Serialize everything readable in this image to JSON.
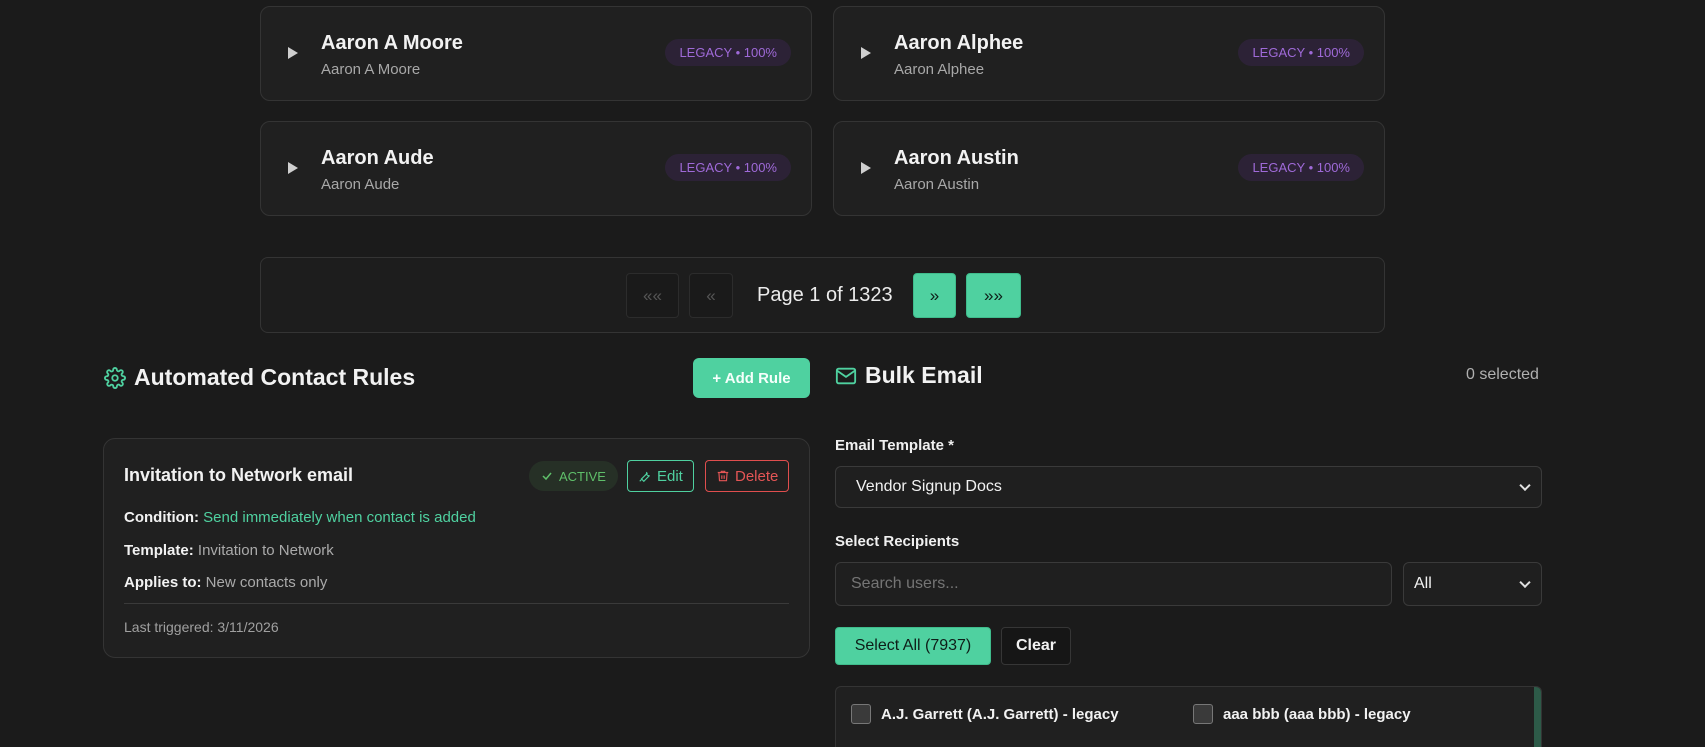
{
  "cards": [
    {
      "name": "Aaron A Moore",
      "sub": "Aaron A Moore",
      "badge": "LEGACY • 100%"
    },
    {
      "name": "Aaron Alphee",
      "sub": "Aaron Alphee",
      "badge": "LEGACY • 100%"
    },
    {
      "name": "Aaron Aude",
      "sub": "Aaron Aude",
      "badge": "LEGACY • 100%"
    },
    {
      "name": "Aaron Austin",
      "sub": "Aaron Austin",
      "badge": "LEGACY • 100%"
    }
  ],
  "pagination": {
    "first_label": "««",
    "prev_label": "«",
    "page_text": "Page 1 of 1323",
    "next_label": "»",
    "last_label": "»»"
  },
  "rules": {
    "title": "Automated Contact Rules",
    "add_label": "+ Add Rule",
    "rule": {
      "name": "Invitation to Network email",
      "status": "ACTIVE",
      "edit_label": "Edit",
      "delete_label": "Delete",
      "condition_label": "Condition:",
      "condition_value": "Send immediately when contact is added",
      "template_label": "Template:",
      "template_value": "Invitation to Network",
      "applies_label": "Applies to:",
      "applies_value": "New contacts only",
      "last_triggered": "Last triggered: 3/11/2026"
    }
  },
  "bulk": {
    "title": "Bulk Email",
    "selected": "0 selected",
    "template_label": "Email Template *",
    "template_value": "Vendor Signup Docs",
    "recipients_label": "Select Recipients",
    "search_placeholder": "Search users...",
    "filter_value": "All",
    "select_all_label": "Select All (7937)",
    "clear_label": "Clear",
    "recipients": [
      "A.J. Garrett (A.J. Garrett) - legacy",
      "aaa bbb (aaa bbb) - legacy"
    ]
  },
  "colors": {
    "accent": "#4fd1a0",
    "badge_purple": "#9f6ad8",
    "danger": "#e45555",
    "active_green": "#5fbf6a"
  }
}
